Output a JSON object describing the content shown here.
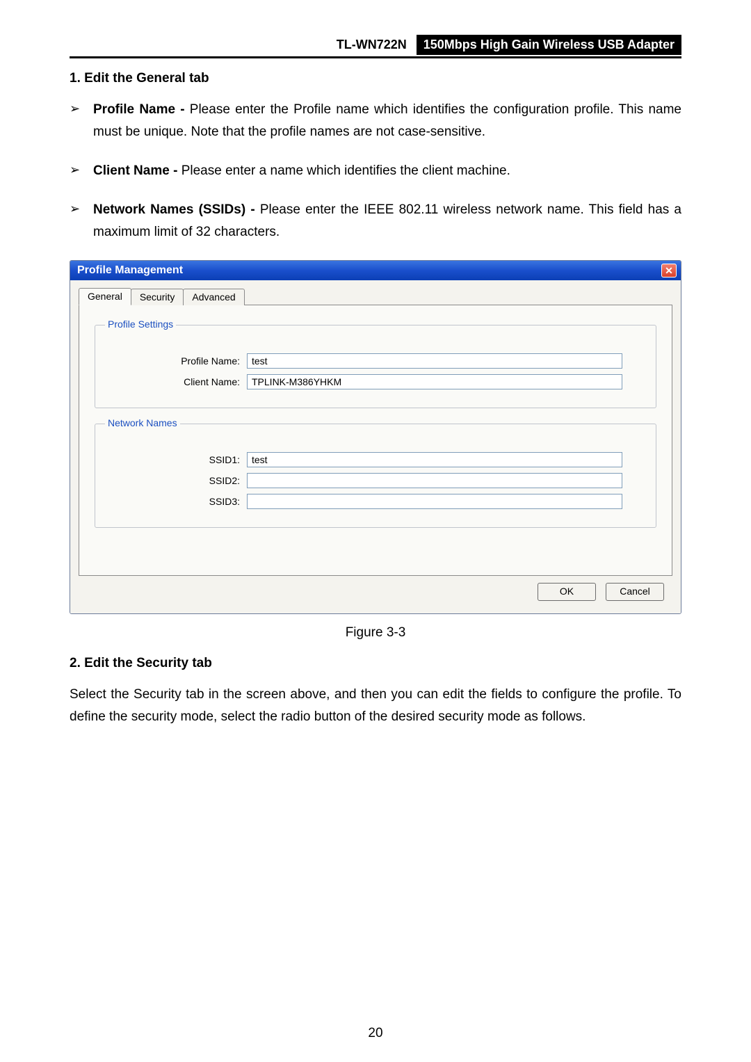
{
  "header": {
    "model": "TL-WN722N",
    "desc": "150Mbps High Gain Wireless USB Adapter"
  },
  "section1": {
    "title": "1.   Edit the General tab",
    "bullets": [
      {
        "label": "Profile Name -",
        "text": " Please enter the Profile name which identifies the configuration profile. This name must be unique. Note that the profile names are not case-sensitive."
      },
      {
        "label": "Client Name -",
        "text": " Please enter a name which identifies the client machine."
      },
      {
        "label": "Network Names (SSIDs) -",
        "text": " Please enter the IEEE 802.11 wireless network name. This field has a maximum limit of 32 characters."
      }
    ]
  },
  "dialog": {
    "title": "Profile Management",
    "tabs": {
      "general": "General",
      "security": "Security",
      "advanced": "Advanced"
    },
    "group1": {
      "legend": "Profile Settings",
      "profile_name_label": "Profile Name:",
      "profile_name_value": "test",
      "client_name_label": "Client Name:",
      "client_name_value": "TPLINK-M386YHKM"
    },
    "group2": {
      "legend": "Network Names",
      "ssid1_label": "SSID1:",
      "ssid1_value": "test",
      "ssid2_label": "SSID2:",
      "ssid2_value": "",
      "ssid3_label": "SSID3:",
      "ssid3_value": ""
    },
    "ok_label": "OK",
    "cancel_label": "Cancel"
  },
  "figure_caption": "Figure 3-3",
  "section2": {
    "title": "2.   Edit the Security tab",
    "para": "Select the Security tab in the screen above, and then you can edit the fields to configure the profile. To define the security mode, select the radio button of the desired security mode as follows."
  },
  "page_number": "20"
}
